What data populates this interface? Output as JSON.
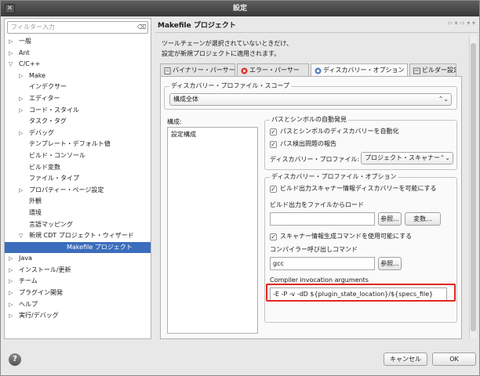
{
  "window": {
    "title": "設定",
    "close_glyph": "✕"
  },
  "filter": {
    "placeholder": "フィルター入力",
    "clear_glyph": "⌫"
  },
  "tree": [
    {
      "label": "一般",
      "indent": 0,
      "arrow": "▷",
      "selected": false
    },
    {
      "label": "Ant",
      "indent": 0,
      "arrow": "▷",
      "selected": false
    },
    {
      "label": "C/C++",
      "indent": 0,
      "arrow": "▽",
      "selected": false
    },
    {
      "label": "Make",
      "indent": 1,
      "arrow": "▷",
      "selected": false
    },
    {
      "label": "インデクサー",
      "indent": 1,
      "arrow": "",
      "selected": false
    },
    {
      "label": "エディター",
      "indent": 1,
      "arrow": "▷",
      "selected": false
    },
    {
      "label": "コード・スタイル",
      "indent": 1,
      "arrow": "▷",
      "selected": false
    },
    {
      "label": "タスク・タグ",
      "indent": 1,
      "arrow": "",
      "selected": false
    },
    {
      "label": "デバッグ",
      "indent": 1,
      "arrow": "▷",
      "selected": false
    },
    {
      "label": "テンプレート・デフォルト値",
      "indent": 1,
      "arrow": "",
      "selected": false
    },
    {
      "label": "ビルド・コンソール",
      "indent": 1,
      "arrow": "",
      "selected": false
    },
    {
      "label": "ビルド変数",
      "indent": 1,
      "arrow": "",
      "selected": false
    },
    {
      "label": "ファイル・タイプ",
      "indent": 1,
      "arrow": "",
      "selected": false
    },
    {
      "label": "プロパティー・ページ設定",
      "indent": 1,
      "arrow": "▷",
      "selected": false
    },
    {
      "label": "外観",
      "indent": 1,
      "arrow": "",
      "selected": false
    },
    {
      "label": "環境",
      "indent": 1,
      "arrow": "",
      "selected": false
    },
    {
      "label": "言語マッピング",
      "indent": 1,
      "arrow": "",
      "selected": false
    },
    {
      "label": "新規 CDT プロジェクト・ウィザード",
      "indent": 1,
      "arrow": "▽",
      "selected": false
    },
    {
      "label": "Makefile プロジェクト",
      "indent": 2,
      "arrow": "",
      "selected": true
    },
    {
      "label": "Java",
      "indent": 0,
      "arrow": "▷",
      "selected": false
    },
    {
      "label": "インストール/更新",
      "indent": 0,
      "arrow": "▷",
      "selected": false
    },
    {
      "label": "チーム",
      "indent": 0,
      "arrow": "▷",
      "selected": false
    },
    {
      "label": "プラグイン開発",
      "indent": 0,
      "arrow": "▷",
      "selected": false
    },
    {
      "label": "ヘルプ",
      "indent": 0,
      "arrow": "▷",
      "selected": false
    },
    {
      "label": "実行/デバッグ",
      "indent": 0,
      "arrow": "▷",
      "selected": false
    }
  ],
  "page": {
    "title": "Makefile プロジェクト",
    "nav": "⇦ ▾ ⇨ ▾ ▾",
    "description_line1": "ツールチェーンが選択されていないときだけ、",
    "description_line2": "設定が新規プロジェクトに適用されます。"
  },
  "tabs": [
    {
      "label": "バイナリー・パーサー",
      "active": false,
      "icon": "document-icon"
    },
    {
      "label": "エラー・パーサー",
      "active": false,
      "icon": "error-icon"
    },
    {
      "label": "ディスカバリー・オプション",
      "active": true,
      "icon": "discovery-icon"
    },
    {
      "label": "ビルダー設定",
      "active": false,
      "icon": "builder-icon"
    }
  ],
  "scope": {
    "group_title": "ディスカバリー・プロファイル・スコープ",
    "value": "構成全体"
  },
  "config": {
    "label": "構成:",
    "items": [
      "設定構成"
    ]
  },
  "auto_discovery": {
    "group_title": "パスとシンボルの自動発見",
    "enable_label": "パスとシンボルのディスカバリーを自動化",
    "report_label": "パス検出問題の報告",
    "profile_label": "ディスカバリー・プロファイル:",
    "profile_value": "プロジェクト・スキャナー"
  },
  "profile_options": {
    "group_title": "ディスカバリー・プロファイル・オプション",
    "build_output_label": "ビルド出力スキャナー情報ディスカバリーを可能にする",
    "load_label": "ビルド出力をファイルからロード",
    "load_value": "",
    "browse_label": "参照...",
    "variables_label": "変数...",
    "scanner_cmd_label": "スキャナー情報生成コマンドを使用可能にする",
    "compiler_cmd_label": "コンパイラー呼び出しコマンド",
    "compiler_value": "gcc",
    "browse2_label": "参照...",
    "args_label": "Compiler invocation arguments",
    "args_value": "-E -P -v -dD ${plugin_state_location}/${specs_file}"
  },
  "footer": {
    "help_glyph": "?",
    "cancel_label": "キャンセル",
    "ok_label": "OK"
  },
  "colors": {
    "selection": "#3b6dbd",
    "highlight": "#e0271f"
  }
}
